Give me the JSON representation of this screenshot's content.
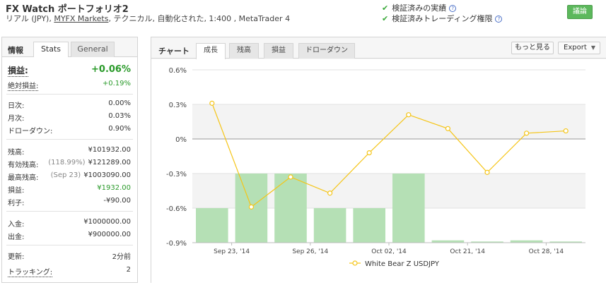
{
  "header": {
    "title": "FX Watch ポートフォリオ2",
    "subtitle_prefix": "リアル (JPY), ",
    "broker_link": "MYFX Markets",
    "subtitle_suffix": ", テクニカル, 自動化された, 1:400 , MetaTrader 4",
    "verify_track": "検証済みの実績",
    "verify_trading": "検証済みトレーディング権限",
    "discuss_button": "議論"
  },
  "left": {
    "section_label": "情報",
    "tab_stats": "Stats",
    "tab_general": "General",
    "rows": {
      "gain_label": "損益:",
      "gain_value": "+0.06%",
      "abs_gain_label": "絶対損益:",
      "abs_gain_value": "+0.19%",
      "daily_label": "日次:",
      "daily_value": "0.00%",
      "monthly_label": "月次:",
      "monthly_value": "0.03%",
      "drawdown_label": "ドローダウン:",
      "drawdown_value": "0.90%",
      "balance_label": "残高:",
      "balance_value": "¥101932.00",
      "equity_label": "有効残高:",
      "equity_pct": "(118.99%)",
      "equity_value": "¥121289.00",
      "highest_label": "最高残高:",
      "highest_date": "(Sep 23)",
      "highest_value": "¥1003090.00",
      "profit_label": "損益:",
      "profit_value": "¥1932.00",
      "interest_label": "利子:",
      "interest_value": "-¥90.00",
      "deposits_label": "入金:",
      "deposits_value": "¥1000000.00",
      "withdrawals_label": "出金:",
      "withdrawals_value": "¥900000.00",
      "updated_label": "更新:",
      "updated_value": "2分前",
      "tracking_label": "トラッキング:",
      "tracking_value": "2"
    }
  },
  "right": {
    "section_label": "チャート",
    "tabs": [
      "成長",
      "残高",
      "損益",
      "ドローダウン"
    ],
    "more_button": "もっと見る",
    "export_button": "Export"
  },
  "chart_data": {
    "type": "line",
    "y_ticks": [
      "0.6%",
      "0.3%",
      "0%",
      "-0.3%",
      "-0.6%",
      "-0.9%"
    ],
    "ylim": [
      -0.9,
      0.6
    ],
    "x_tick_labels": [
      "Sep 23, '14",
      "Sep 26, '14",
      "Oct 02, '14",
      "Oct 21, '14",
      "Oct 28, '14"
    ],
    "x_tick_index": [
      0.5,
      2.5,
      4.5,
      6.5,
      8.5
    ],
    "series": [
      {
        "name": "White Bear Z USDJPY",
        "color": "#f5c518",
        "values": [
          0.31,
          -0.59,
          -0.33,
          -0.47,
          -0.12,
          0.21,
          0.09,
          -0.29,
          0.05,
          0.07
        ]
      }
    ],
    "bars": [
      0.3,
      0.6,
      0.6,
      0.3,
      0.3,
      0.6,
      0.02,
      0.01,
      0.02,
      0.01
    ],
    "bar_color": "#b5e0b5",
    "grid": true,
    "legend_position": "bottom"
  }
}
